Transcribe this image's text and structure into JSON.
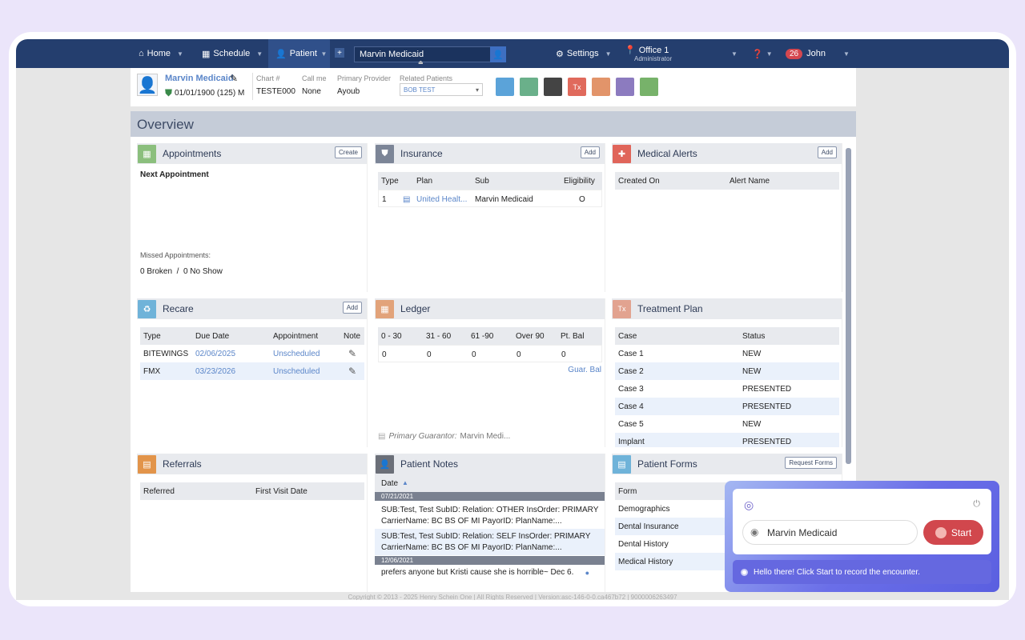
{
  "nav": {
    "home": "Home",
    "schedule": "Schedule",
    "patient": "Patient",
    "search_value": "Marvin Medicaid",
    "settings": "Settings",
    "office": "Office 1",
    "office_role": "Administrator",
    "notif_count": "26",
    "user": "John"
  },
  "patient": {
    "name": "Marvin Medicaid",
    "dob": "01/01/1900 (125) M",
    "chart_label": "Chart #",
    "chart": "TESTE000",
    "callme_label": "Call me",
    "callme": "None",
    "provider_label": "Primary Provider",
    "provider": "Ayoub",
    "related_label": "Related Patients",
    "related": "BOB TEST"
  },
  "toolbar": [
    {
      "name": "tooth-icon",
      "label": "",
      "color": "#5ba3d9"
    },
    {
      "name": "image-icon",
      "label": "",
      "color": "#6ab08a"
    },
    {
      "name": "film-icon",
      "label": "",
      "color": "#444"
    },
    {
      "name": "tx-icon",
      "label": "Tx",
      "color": "#e06a5c"
    },
    {
      "name": "ledger-icon",
      "label": "",
      "color": "#e2946a"
    },
    {
      "name": "forms-icon",
      "label": "",
      "color": "#8c7bbf"
    },
    {
      "name": "calendar-icon",
      "label": "",
      "color": "#77b26a"
    }
  ],
  "overview": "Overview",
  "appointments": {
    "title": "Appointments",
    "btn": "Create",
    "next": "Next Appointment",
    "missed_label": "Missed Appointments:",
    "broken": "0 Broken",
    "sep": "/",
    "noshow": "0 No Show"
  },
  "insurance": {
    "title": "Insurance",
    "btn": "Add",
    "cols": [
      "Type",
      "Plan",
      "Sub",
      "Eligibility"
    ],
    "row": {
      "type": "1",
      "plan": "United Healt...",
      "sub": "Marvin Medicaid",
      "elig": "O"
    }
  },
  "alerts": {
    "title": "Medical Alerts",
    "btn": "Add",
    "cols": [
      "Created On",
      "Alert Name"
    ]
  },
  "recare": {
    "title": "Recare",
    "btn": "Add",
    "cols": [
      "Type",
      "Due Date",
      "Appointment",
      "Note"
    ],
    "rows": [
      {
        "type": "BITEWINGS",
        "due": "02/06/2025",
        "appt": "Unscheduled"
      },
      {
        "type": "FMX",
        "due": "03/23/2026",
        "appt": "Unscheduled"
      }
    ]
  },
  "ledger": {
    "title": "Ledger",
    "cols": [
      "0 - 30",
      "31 - 60",
      "61 -90",
      "Over 90",
      "Pt. Bal"
    ],
    "vals": [
      "0",
      "0",
      "0",
      "0",
      "0"
    ],
    "guar_bal": "Guar. Bal",
    "guarantor_label": "Primary Guarantor:",
    "guarantor": "Marvin Medi..."
  },
  "treatment": {
    "title": "Treatment Plan",
    "cols": [
      "Case",
      "Status"
    ],
    "rows": [
      {
        "case": "Case 1",
        "status": "NEW"
      },
      {
        "case": "Case 2",
        "status": "NEW"
      },
      {
        "case": "Case 3",
        "status": "PRESENTED"
      },
      {
        "case": "Case 4",
        "status": "PRESENTED"
      },
      {
        "case": "Case 5",
        "status": "NEW"
      },
      {
        "case": "Implant",
        "status": "PRESENTED"
      }
    ]
  },
  "referrals": {
    "title": "Referrals",
    "cols": [
      "Referred",
      "First Visit Date"
    ]
  },
  "notes": {
    "title": "Patient Notes",
    "col": "Date",
    "d1": "07/21/2021",
    "n1a": "SUB:Test, Test SubID: Relation: OTHER InsOrder: PRIMARY",
    "n1b": "CarrierName: BC BS OF MI PayorID: PlanName:...",
    "n2a": "SUB:Test, Test SubID: Relation: SELF InsOrder: PRIMARY",
    "n2b": "CarrierName: BC BS OF MI PayorID: PlanName:...",
    "d2": "12/06/2021",
    "n3": "prefers anyone but Kristi cause she is horrible~ Dec 6."
  },
  "forms": {
    "title": "Patient Forms",
    "btn": "Request Forms",
    "col": "Form",
    "rows": [
      "Demographics",
      "Dental Insurance",
      "Dental History",
      "Medical History"
    ]
  },
  "copyright": "Copyright © 2013 - 2025 Henry Schein One | All Rights Reserved | Version:asc-146-0-0.ca467b72 | 9000006263497",
  "widget": {
    "name": "Marvin Medicaid",
    "start": "Start",
    "message": "Hello there! Click Start to record the encounter."
  }
}
